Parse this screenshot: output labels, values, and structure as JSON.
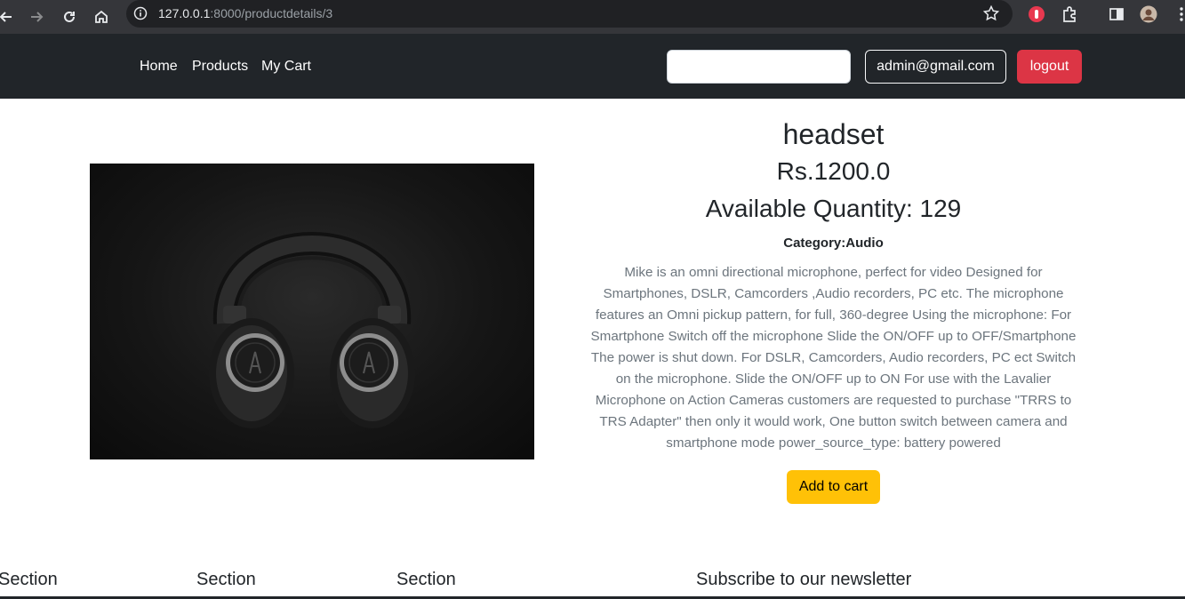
{
  "browser": {
    "url_host": "127.0.0.1",
    "url_path": ":8000/productdetails/3"
  },
  "navbar": {
    "links": [
      {
        "label": "Home"
      },
      {
        "label": "Products"
      },
      {
        "label": "My Cart"
      }
    ],
    "search_value": "",
    "user_label": "admin@gmail.com",
    "logout_label": "logout"
  },
  "product": {
    "title": "headset",
    "price": "Rs.1200.0",
    "quantity": "Available Quantity: 129",
    "category": "Category:Audio",
    "description": "Mike is an omni directional microphone, perfect for video Designed for Smartphones, DSLR, Camcorders ,Audio recorders, PC etc. The microphone features an Omni pickup pattern, for full, 360-degree Using the microphone: For Smartphone Switch off the microphone Slide the ON/OFF up to OFF/Smartphone The power is shut down. For DSLR, Camcorders, Audio recorders, PC ect Switch on the microphone. Slide the ON/OFF up to ON For use with the Lavalier Microphone on Action Cameras customers are requested to purchase \"TRRS to TRS Adapter\" then only it would work, One button switch between camera and smartphone mode power_source_type: battery powered",
    "add_to_cart_label": "Add to cart"
  },
  "footer": {
    "headings": [
      "Section",
      "Section",
      "Section",
      "Subscribe to our newsletter"
    ]
  },
  "colors": {
    "navbar_bg": "#212529",
    "logout": "#dc3545",
    "add_to_cart": "#ffc107"
  }
}
